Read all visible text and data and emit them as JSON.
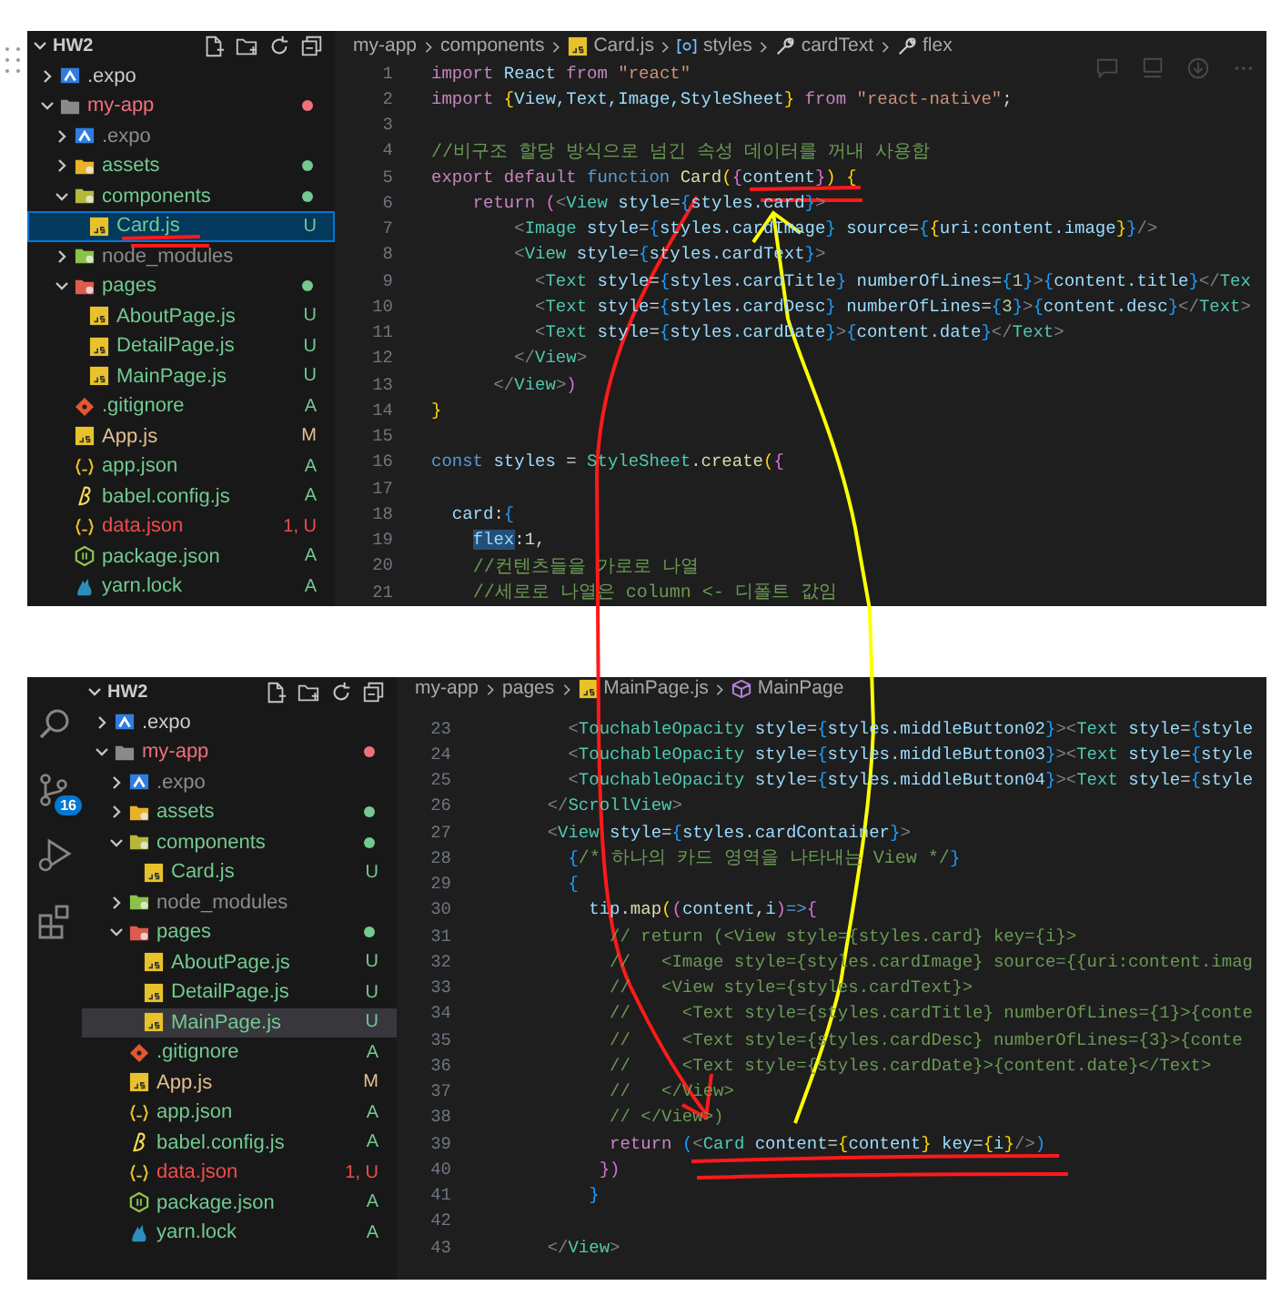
{
  "panels": [
    {
      "explorer": {
        "title": "HW2",
        "focused": true,
        "tree": [
          {
            "name": ".expo",
            "kind": "expo",
            "color": "#cccccc",
            "expanded": false,
            "selected": false
          },
          {
            "name": "my-app",
            "kind": "folder",
            "color": "#f0707a",
            "expanded": true,
            "dot": true,
            "selected": false,
            "children": [
              {
                "name": ".expo",
                "kind": "expo",
                "color": "#8c8c8c",
                "expanded": false,
                "selected": false
              },
              {
                "name": "assets",
                "kind": "folder-assets",
                "color": "#73c991",
                "expanded": false,
                "dot": true,
                "selected": false
              },
              {
                "name": "components",
                "kind": "folder-components",
                "color": "#73c991",
                "expanded": true,
                "dot": true,
                "selected": false,
                "children": [
                  {
                    "name": "Card.js",
                    "kind": "js",
                    "color": "#73c991",
                    "badge": "U",
                    "selected": true
                  }
                ]
              },
              {
                "name": "node_modules",
                "kind": "folder-node",
                "color": "#8c8c8c",
                "expanded": false,
                "selected": false
              },
              {
                "name": "pages",
                "kind": "folder-pages",
                "color": "#73c991",
                "expanded": true,
                "dot": true,
                "selected": false,
                "children": [
                  {
                    "name": "AboutPage.js",
                    "kind": "js",
                    "color": "#73c991",
                    "badge": "U",
                    "selected": false
                  },
                  {
                    "name": "DetailPage.js",
                    "kind": "js",
                    "color": "#73c991",
                    "badge": "U",
                    "selected": false
                  },
                  {
                    "name": "MainPage.js",
                    "kind": "js",
                    "color": "#73c991",
                    "badge": "U",
                    "selected": false
                  }
                ]
              },
              {
                "name": ".gitignore",
                "kind": "git",
                "color": "#73c991",
                "badge": "A",
                "selected": false
              },
              {
                "name": "App.js",
                "kind": "js",
                "color": "#e2c08d",
                "badge": "M",
                "selected": false
              },
              {
                "name": "app.json",
                "kind": "json",
                "color": "#73c991",
                "badge": "A",
                "selected": false
              },
              {
                "name": "babel.config.js",
                "kind": "babel",
                "color": "#73c991",
                "badge": "A",
                "selected": false
              },
              {
                "name": "data.json",
                "kind": "json",
                "color": "#f14c4c",
                "badge": "1, U",
                "selected": false
              },
              {
                "name": "package.json",
                "kind": "node",
                "color": "#73c991",
                "badge": "A",
                "selected": false
              },
              {
                "name": "yarn.lock",
                "kind": "yarn",
                "color": "#73c991",
                "badge": "A",
                "selected": false
              }
            ]
          }
        ]
      },
      "breadcrumb": [
        {
          "kind": "text",
          "label": "my-app"
        },
        {
          "kind": "text",
          "label": "components"
        },
        {
          "kind": "js",
          "label": "Card.js"
        },
        {
          "kind": "object",
          "label": "styles"
        },
        {
          "kind": "property",
          "label": "cardText"
        },
        {
          "kind": "property",
          "label": "flex"
        }
      ],
      "lines": [
        {
          "n": "1",
          "code": [
            {
              "kind": "kw",
              "text": "import "
            },
            {
              "kind": "var",
              "text": "React "
            },
            {
              "kind": "kw",
              "text": "from "
            },
            {
              "kind": "str",
              "text": "\"react\""
            }
          ]
        },
        {
          "n": "2",
          "code": [
            {
              "kind": "kw",
              "text": "import "
            },
            {
              "kind": "br",
              "text": "{"
            },
            {
              "kind": "var",
              "text": "View,Text,Image,StyleSheet"
            },
            {
              "kind": "br",
              "text": "}"
            },
            {
              "kind": "kw",
              "text": " from "
            },
            {
              "kind": "str",
              "text": "\"react-native\""
            },
            {
              "kind": "pl",
              "text": ";"
            }
          ]
        },
        {
          "n": "3"
        },
        {
          "n": "4",
          "code": [
            {
              "kind": "cmk",
              "text": "//비구조 할당 방식으로 넘긴 속성 데이터를 꺼내 사용함"
            }
          ]
        },
        {
          "n": "5",
          "code": [
            {
              "kind": "kw",
              "text": "export default "
            },
            {
              "kind": "st",
              "text": "function "
            },
            {
              "kind": "fn",
              "text": "Card"
            },
            {
              "kind": "br",
              "text": "("
            },
            {
              "kind": "br2",
              "text": "{"
            },
            {
              "kind": "var",
              "text": "content"
            },
            {
              "kind": "br2",
              "text": "}"
            },
            {
              "kind": "br",
              "text": ") {"
            }
          ]
        },
        {
          "n": "6",
          "code": [
            {
              "kind": "kw",
              "text": "    return "
            },
            {
              "kind": "br2",
              "text": "("
            },
            {
              "kind": "pu",
              "text": "<"
            },
            {
              "kind": "tag",
              "text": "View "
            },
            {
              "kind": "var",
              "text": "style"
            },
            {
              "kind": "pl",
              "text": "="
            },
            {
              "kind": "br3",
              "text": "{"
            },
            {
              "kind": "var",
              "text": "styles.card"
            },
            {
              "kind": "br3",
              "text": "}"
            },
            {
              "kind": "pu",
              "text": ">"
            }
          ]
        },
        {
          "n": "7",
          "code": [
            {
              "kind": "pu",
              "text": "        <"
            },
            {
              "kind": "tag",
              "text": "Image "
            },
            {
              "kind": "var",
              "text": "style"
            },
            {
              "kind": "pl",
              "text": "="
            },
            {
              "kind": "br3",
              "text": "{"
            },
            {
              "kind": "var",
              "text": "styles.cardImage"
            },
            {
              "kind": "br3",
              "text": "} "
            },
            {
              "kind": "var",
              "text": "source"
            },
            {
              "kind": "pl",
              "text": "="
            },
            {
              "kind": "br3",
              "text": "{"
            },
            {
              "kind": "br",
              "text": "{"
            },
            {
              "kind": "var",
              "text": "uri:content.image"
            },
            {
              "kind": "br",
              "text": "}"
            },
            {
              "kind": "br3",
              "text": "}"
            },
            {
              "kind": "pu",
              "text": "/>"
            }
          ]
        },
        {
          "n": "8",
          "code": [
            {
              "kind": "pu",
              "text": "        <"
            },
            {
              "kind": "tag",
              "text": "View "
            },
            {
              "kind": "var",
              "text": "style"
            },
            {
              "kind": "pl",
              "text": "="
            },
            {
              "kind": "br3",
              "text": "{"
            },
            {
              "kind": "var",
              "text": "styles.cardText"
            },
            {
              "kind": "br3",
              "text": "}"
            },
            {
              "kind": "pu",
              "text": ">"
            }
          ]
        },
        {
          "n": "9",
          "code": [
            {
              "kind": "pu",
              "text": "          <"
            },
            {
              "kind": "tag",
              "text": "Text "
            },
            {
              "kind": "var",
              "text": "style"
            },
            {
              "kind": "pl",
              "text": "="
            },
            {
              "kind": "br3",
              "text": "{"
            },
            {
              "kind": "var",
              "text": "styles.cardTitle"
            },
            {
              "kind": "br3",
              "text": "} "
            },
            {
              "kind": "var",
              "text": "numberOfLines"
            },
            {
              "kind": "pl",
              "text": "="
            },
            {
              "kind": "br3",
              "text": "{"
            },
            {
              "kind": "num",
              "text": "1"
            },
            {
              "kind": "br3",
              "text": "}"
            },
            {
              "kind": "pu",
              "text": ">"
            },
            {
              "kind": "br3",
              "text": "{"
            },
            {
              "kind": "var",
              "text": "content.title"
            },
            {
              "kind": "br3",
              "text": "}"
            },
            {
              "kind": "pu",
              "text": "</"
            },
            {
              "kind": "tag",
              "text": "Tex"
            }
          ]
        },
        {
          "n": "10",
          "code": [
            {
              "kind": "pu",
              "text": "          <"
            },
            {
              "kind": "tag",
              "text": "Text "
            },
            {
              "kind": "var",
              "text": "style"
            },
            {
              "kind": "pl",
              "text": "="
            },
            {
              "kind": "br3",
              "text": "{"
            },
            {
              "kind": "var",
              "text": "styles.cardDesc"
            },
            {
              "kind": "br3",
              "text": "} "
            },
            {
              "kind": "var",
              "text": "numberOfLines"
            },
            {
              "kind": "pl",
              "text": "="
            },
            {
              "kind": "br3",
              "text": "{"
            },
            {
              "kind": "num",
              "text": "3"
            },
            {
              "kind": "br3",
              "text": "}"
            },
            {
              "kind": "pu",
              "text": ">"
            },
            {
              "kind": "br3",
              "text": "{"
            },
            {
              "kind": "var",
              "text": "content.desc"
            },
            {
              "kind": "br3",
              "text": "}"
            },
            {
              "kind": "pu",
              "text": "</"
            },
            {
              "kind": "tag",
              "text": "Text"
            },
            {
              "kind": "pu",
              "text": ">"
            }
          ]
        },
        {
          "n": "11",
          "code": [
            {
              "kind": "pu",
              "text": "          <"
            },
            {
              "kind": "tag",
              "text": "Text "
            },
            {
              "kind": "var",
              "text": "style"
            },
            {
              "kind": "pl",
              "text": "="
            },
            {
              "kind": "br3",
              "text": "{"
            },
            {
              "kind": "var",
              "text": "styles.cardDate"
            },
            {
              "kind": "br3",
              "text": "}"
            },
            {
              "kind": "pu",
              "text": ">"
            },
            {
              "kind": "br3",
              "text": "{"
            },
            {
              "kind": "var",
              "text": "content.date"
            },
            {
              "kind": "br3",
              "text": "}"
            },
            {
              "kind": "pu",
              "text": "</"
            },
            {
              "kind": "tag",
              "text": "Text"
            },
            {
              "kind": "pu",
              "text": ">"
            }
          ]
        },
        {
          "n": "12",
          "code": [
            {
              "kind": "pu",
              "text": "        </"
            },
            {
              "kind": "tag",
              "text": "View"
            },
            {
              "kind": "pu",
              "text": ">"
            }
          ]
        },
        {
          "n": "13",
          "code": [
            {
              "kind": "pu",
              "text": "      </"
            },
            {
              "kind": "tag",
              "text": "View"
            },
            {
              "kind": "pu",
              "text": ">"
            },
            {
              "kind": "br2",
              "text": ")"
            }
          ]
        },
        {
          "n": "14",
          "code": [
            {
              "kind": "br",
              "text": "}"
            }
          ]
        },
        {
          "n": "15"
        },
        {
          "n": "16",
          "code": [
            {
              "kind": "st",
              "text": "const "
            },
            {
              "kind": "var",
              "text": "styles "
            },
            {
              "kind": "pl",
              "text": "= "
            },
            {
              "kind": "tag",
              "text": "StyleSheet"
            },
            {
              "kind": "pl",
              "text": "."
            },
            {
              "kind": "fn",
              "text": "create"
            },
            {
              "kind": "br",
              "text": "("
            },
            {
              "kind": "br2",
              "text": "{"
            }
          ]
        },
        {
          "n": "17"
        },
        {
          "n": "18",
          "code": [
            {
              "kind": "var",
              "text": "  card"
            },
            {
              "kind": "pl",
              "text": ":"
            },
            {
              "kind": "br3",
              "text": "{"
            }
          ]
        },
        {
          "n": "19",
          "code": [
            {
              "kind": "hl",
              "text": "    flex"
            },
            {
              "kind": "pl",
              "text": ":1,"
            }
          ]
        },
        {
          "n": "20",
          "code": [
            {
              "kind": "cmk",
              "text": "    //컨텐츠들을 가로로 나열"
            }
          ]
        },
        {
          "n": "21",
          "code": [
            {
              "kind": "cmk",
              "text": "    //세로로 나열은 column <- 디폴트 값임"
            }
          ]
        }
      ]
    },
    {
      "activity_bar": [
        {
          "kind": "search"
        },
        {
          "kind": "source-control",
          "badge": "16"
        },
        {
          "kind": "run"
        },
        {
          "kind": "extensions"
        }
      ],
      "explorer": {
        "title": "HW2",
        "focused": false,
        "tree": [
          {
            "name": ".expo",
            "kind": "expo",
            "color": "#cccccc",
            "expanded": false,
            "selected": false
          },
          {
            "name": "my-app",
            "kind": "folder",
            "color": "#f0707a",
            "expanded": true,
            "dot": true,
            "selected": false,
            "children": [
              {
                "name": ".expo",
                "kind": "expo",
                "color": "#8c8c8c",
                "expanded": false,
                "selected": false
              },
              {
                "name": "assets",
                "kind": "folder-assets",
                "color": "#73c991",
                "expanded": false,
                "dot": true,
                "selected": false
              },
              {
                "name": "components",
                "kind": "folder-components",
                "color": "#73c991",
                "expanded": true,
                "dot": true,
                "selected": false,
                "children": [
                  {
                    "name": "Card.js",
                    "kind": "js",
                    "color": "#73c991",
                    "badge": "U",
                    "selected": false
                  }
                ]
              },
              {
                "name": "node_modules",
                "kind": "folder-node",
                "color": "#8c8c8c",
                "expanded": false,
                "selected": false
              },
              {
                "name": "pages",
                "kind": "folder-pages",
                "color": "#73c991",
                "expanded": true,
                "dot": true,
                "selected": false,
                "children": [
                  {
                    "name": "AboutPage.js",
                    "kind": "js",
                    "color": "#73c991",
                    "badge": "U",
                    "selected": false
                  },
                  {
                    "name": "DetailPage.js",
                    "kind": "js",
                    "color": "#73c991",
                    "badge": "U",
                    "selected": false
                  },
                  {
                    "name": "MainPage.js",
                    "kind": "js",
                    "color": "#73c991",
                    "badge": "U",
                    "selected": true
                  }
                ]
              },
              {
                "name": ".gitignore",
                "kind": "git",
                "color": "#73c991",
                "badge": "A",
                "selected": false
              },
              {
                "name": "App.js",
                "kind": "js",
                "color": "#e2c08d",
                "badge": "M",
                "selected": false
              },
              {
                "name": "app.json",
                "kind": "json",
                "color": "#73c991",
                "badge": "A",
                "selected": false
              },
              {
                "name": "babel.config.js",
                "kind": "babel",
                "color": "#73c991",
                "badge": "A",
                "selected": false
              },
              {
                "name": "data.json",
                "kind": "json",
                "color": "#f14c4c",
                "badge": "1, U",
                "selected": false
              },
              {
                "name": "package.json",
                "kind": "node",
                "color": "#73c991",
                "badge": "A",
                "selected": false
              },
              {
                "name": "yarn.lock",
                "kind": "yarn",
                "color": "#73c991",
                "badge": "A",
                "selected": false
              }
            ]
          }
        ]
      },
      "breadcrumb": [
        {
          "kind": "text",
          "label": "my-app"
        },
        {
          "kind": "text",
          "label": "pages"
        },
        {
          "kind": "js",
          "label": "MainPage.js"
        },
        {
          "kind": "component",
          "label": "MainPage"
        }
      ],
      "lines": [
        {
          "n": "23",
          "code": [
            {
              "kind": "pu",
              "text": "      <"
            },
            {
              "kind": "tag",
              "text": "TouchableOpacity "
            },
            {
              "kind": "var",
              "text": "style"
            },
            {
              "kind": "pl",
              "text": "="
            },
            {
              "kind": "br3",
              "text": "{"
            },
            {
              "kind": "var",
              "text": "styles.middleButton02"
            },
            {
              "kind": "br3",
              "text": "}"
            },
            {
              "kind": "pu",
              "text": "><"
            },
            {
              "kind": "tag",
              "text": "Text "
            },
            {
              "kind": "var",
              "text": "style"
            },
            {
              "kind": "pl",
              "text": "="
            },
            {
              "kind": "br3",
              "text": "{"
            },
            {
              "kind": "var",
              "text": "style"
            }
          ]
        },
        {
          "n": "24",
          "code": [
            {
              "kind": "pu",
              "text": "      <"
            },
            {
              "kind": "tag",
              "text": "TouchableOpacity "
            },
            {
              "kind": "var",
              "text": "style"
            },
            {
              "kind": "pl",
              "text": "="
            },
            {
              "kind": "br3",
              "text": "{"
            },
            {
              "kind": "var",
              "text": "styles.middleButton03"
            },
            {
              "kind": "br3",
              "text": "}"
            },
            {
              "kind": "pu",
              "text": "><"
            },
            {
              "kind": "tag",
              "text": "Text "
            },
            {
              "kind": "var",
              "text": "style"
            },
            {
              "kind": "pl",
              "text": "="
            },
            {
              "kind": "br3",
              "text": "{"
            },
            {
              "kind": "var",
              "text": "style"
            }
          ]
        },
        {
          "n": "25",
          "code": [
            {
              "kind": "pu",
              "text": "      <"
            },
            {
              "kind": "tag",
              "text": "TouchableOpacity "
            },
            {
              "kind": "var",
              "text": "style"
            },
            {
              "kind": "pl",
              "text": "="
            },
            {
              "kind": "br3",
              "text": "{"
            },
            {
              "kind": "var",
              "text": "styles.middleButton04"
            },
            {
              "kind": "br3",
              "text": "}"
            },
            {
              "kind": "pu",
              "text": "><"
            },
            {
              "kind": "tag",
              "text": "Text "
            },
            {
              "kind": "var",
              "text": "style"
            },
            {
              "kind": "pl",
              "text": "="
            },
            {
              "kind": "br3",
              "text": "{"
            },
            {
              "kind": "var",
              "text": "style"
            }
          ]
        },
        {
          "n": "26",
          "code": [
            {
              "kind": "pu",
              "text": "    </"
            },
            {
              "kind": "tag",
              "text": "ScrollView"
            },
            {
              "kind": "pu",
              "text": ">"
            }
          ]
        },
        {
          "n": "27",
          "code": [
            {
              "kind": "pu",
              "text": "    <"
            },
            {
              "kind": "tag",
              "text": "View "
            },
            {
              "kind": "var",
              "text": "style"
            },
            {
              "kind": "pl",
              "text": "="
            },
            {
              "kind": "br3",
              "text": "{"
            },
            {
              "kind": "var",
              "text": "styles.cardContainer"
            },
            {
              "kind": "br3",
              "text": "}"
            },
            {
              "kind": "pu",
              "text": ">"
            }
          ]
        },
        {
          "n": "28",
          "code": [
            {
              "kind": "br3",
              "text": "      {"
            },
            {
              "kind": "cmk",
              "text": "/* 하나의 카드 영역을 나타내는 View */"
            },
            {
              "kind": "br3",
              "text": "}"
            }
          ]
        },
        {
          "n": "29",
          "code": [
            {
              "kind": "br3",
              "text": "      {"
            }
          ]
        },
        {
          "n": "30",
          "code": [
            {
              "kind": "var",
              "text": "        tip"
            },
            {
              "kind": "pl",
              "text": "."
            },
            {
              "kind": "fn",
              "text": "map"
            },
            {
              "kind": "br",
              "text": "("
            },
            {
              "kind": "br2",
              "text": "("
            },
            {
              "kind": "var",
              "text": "content"
            },
            {
              "kind": "pl",
              "text": ","
            },
            {
              "kind": "var",
              "text": "i"
            },
            {
              "kind": "br2",
              "text": ")"
            },
            {
              "kind": "st",
              "text": "=>"
            },
            {
              "kind": "br2",
              "text": "{"
            }
          ]
        },
        {
          "n": "31",
          "code": [
            {
              "kind": "cm",
              "text": "          // return (<View style={styles.card} key={i}>"
            }
          ]
        },
        {
          "n": "32",
          "code": [
            {
              "kind": "cm",
              "text": "          //   <Image style={styles.cardImage} source={{uri:content.imag"
            }
          ]
        },
        {
          "n": "33",
          "code": [
            {
              "kind": "cm",
              "text": "          //   <View style={styles.cardText}>"
            }
          ]
        },
        {
          "n": "34",
          "code": [
            {
              "kind": "cm",
              "text": "          //     <Text style={styles.cardTitle} numberOfLines={1}>{conte"
            }
          ]
        },
        {
          "n": "35",
          "code": [
            {
              "kind": "cm",
              "text": "          //     <Text style={styles.cardDesc} numberOfLines={3}>{conte"
            }
          ]
        },
        {
          "n": "36",
          "code": [
            {
              "kind": "cm",
              "text": "          //     <Text style={styles.cardDate}>{content.date}</Text>"
            }
          ]
        },
        {
          "n": "37",
          "code": [
            {
              "kind": "cm",
              "text": "          //   </View>"
            }
          ]
        },
        {
          "n": "38",
          "code": [
            {
              "kind": "cm",
              "text": "          // </View>)"
            }
          ]
        },
        {
          "n": "39",
          "code": [
            {
              "kind": "kw",
              "text": "          return "
            },
            {
              "kind": "br3",
              "text": "("
            },
            {
              "kind": "pu",
              "text": "<"
            },
            {
              "kind": "tag",
              "text": "Card "
            },
            {
              "kind": "var",
              "text": "content"
            },
            {
              "kind": "pl",
              "text": "="
            },
            {
              "kind": "br",
              "text": "{"
            },
            {
              "kind": "var",
              "text": "content"
            },
            {
              "kind": "br",
              "text": "} "
            },
            {
              "kind": "var",
              "text": "key"
            },
            {
              "kind": "pl",
              "text": "="
            },
            {
              "kind": "br",
              "text": "{"
            },
            {
              "kind": "var",
              "text": "i"
            },
            {
              "kind": "br",
              "text": "}"
            },
            {
              "kind": "pu",
              "text": "/>"
            },
            {
              "kind": "br3",
              "text": ")"
            }
          ]
        },
        {
          "n": "40",
          "code": [
            {
              "kind": "br2",
              "text": "         })"
            }
          ]
        },
        {
          "n": "41",
          "code": [
            {
              "kind": "br3",
              "text": "        }"
            }
          ]
        },
        {
          "n": "42"
        },
        {
          "n": "43",
          "code": [
            {
              "kind": "pu",
              "text": "    </"
            },
            {
              "kind": "tag",
              "text": "View"
            },
            {
              "kind": "pu",
              "text": ">"
            }
          ]
        }
      ]
    }
  ]
}
